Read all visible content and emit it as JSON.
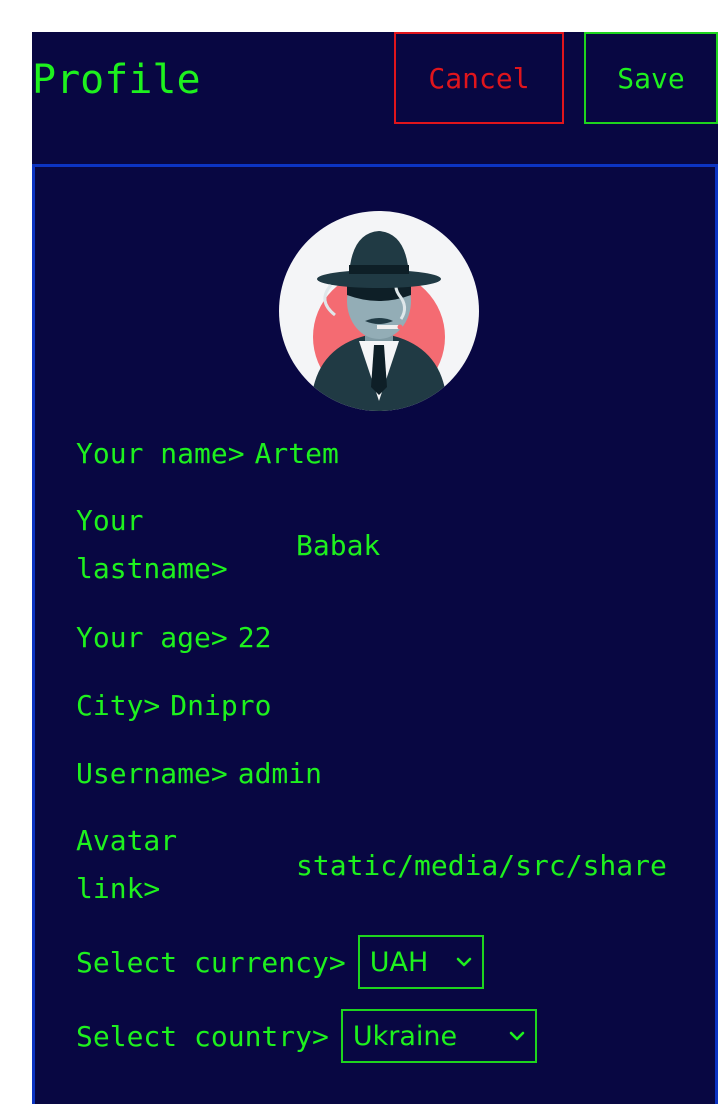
{
  "header": {
    "title": "Profile",
    "cancel_label": "Cancel",
    "save_label": "Save"
  },
  "colors": {
    "background": "#080742",
    "accent_green": "#1ef11e",
    "cancel_red": "#e0151c",
    "card_border_blue": "#0c34c2"
  },
  "avatar": {
    "icon": "detective-avatar-icon"
  },
  "fields": {
    "name": {
      "label": "Your name>",
      "value": "Artem"
    },
    "lastname": {
      "label": "Your lastname>",
      "value": "Babak"
    },
    "age": {
      "label": "Your age>",
      "value": "22"
    },
    "city": {
      "label": "City>",
      "value": "Dnipro"
    },
    "username": {
      "label": "Username>",
      "value": "admin"
    },
    "avatar_link": {
      "label": "Avatar link>",
      "value": "static/media/src/share"
    }
  },
  "currency": {
    "label": "Select currency>",
    "selected": "UAH"
  },
  "country": {
    "label": "Select country>",
    "selected": "Ukraine"
  }
}
